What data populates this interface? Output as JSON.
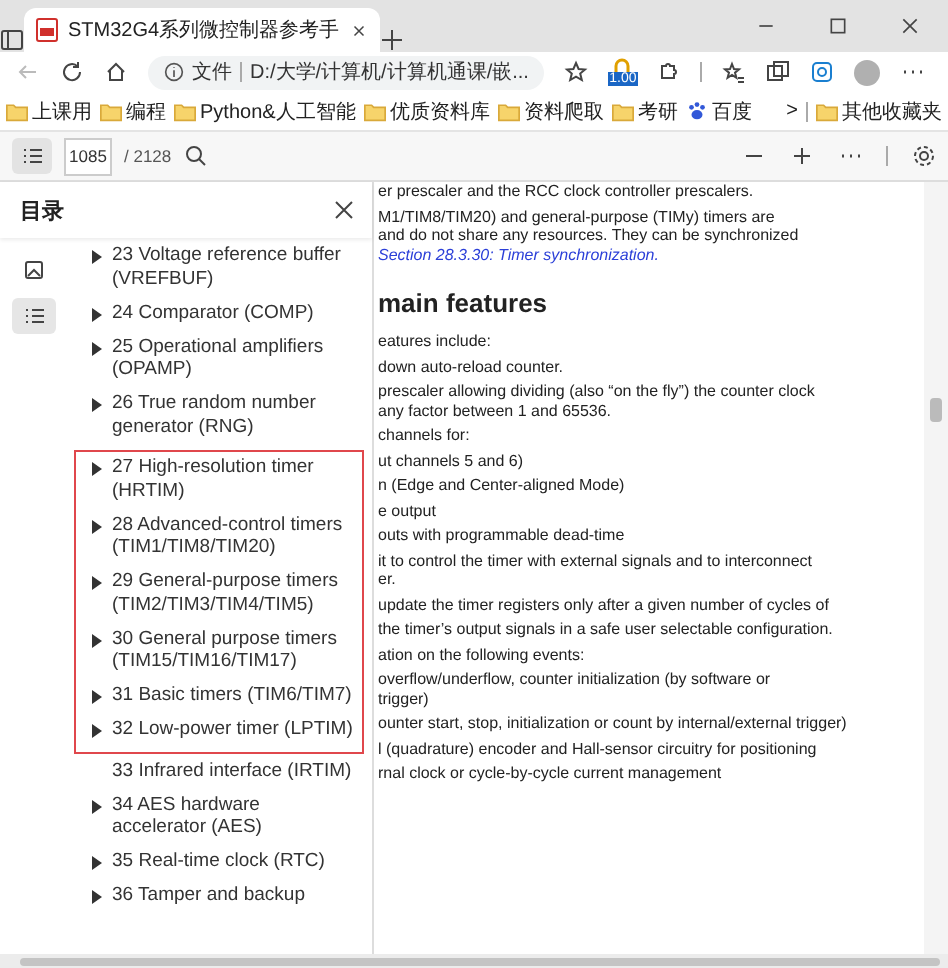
{
  "browser": {
    "tab_title": "STM32G4系列微控制器参考手",
    "address_label": "文件",
    "address": "D:/大学/计算机/计算机通课/嵌...",
    "extension_badge": "1.00",
    "bookmarks": [
      "上课用",
      "编程",
      "Python&人工智能",
      "优质资料库",
      "资料爬取",
      "考研"
    ],
    "baidu": "百度",
    "more": ">",
    "other_bookmarks": "其他收藏夹"
  },
  "pdf_toolbar": {
    "page": "1085",
    "total": "/ 2128"
  },
  "sidebar": {
    "title": "目录",
    "rail": [
      {
        "kind": "thumbnails",
        "selected": false
      },
      {
        "kind": "outline",
        "selected": true
      }
    ],
    "sections": [
      {
        "highlighted": false,
        "items": [
          {
            "label": "23 Voltage reference buffer (VREFBUF)",
            "expandable": true
          },
          {
            "label": "24 Comparator (COMP)",
            "expandable": true
          },
          {
            "label": "25 Operational amplifiers (OPAMP)",
            "expandable": true
          },
          {
            "label": "26 True random number generator (RNG)",
            "expandable": true
          }
        ]
      },
      {
        "highlighted": true,
        "items": [
          {
            "label": "27 High-resolution timer (HRTIM)",
            "expandable": true
          },
          {
            "label": "28 Advanced-control timers (TIM1/TIM8/TIM20)",
            "expandable": true
          },
          {
            "label": "29 General-purpose timers (TIM2/TIM3/TIM4/TIM5)",
            "expandable": true
          },
          {
            "label": "30 General purpose timers (TIM15/TIM16/TIM17)",
            "expandable": true
          },
          {
            "label": "31 Basic timers (TIM6/TIM7)",
            "expandable": true
          },
          {
            "label": "32 Low-power timer (LPTIM)",
            "expandable": true
          }
        ]
      },
      {
        "highlighted": false,
        "items": [
          {
            "label": "33 Infrared interface (IRTIM)",
            "expandable": false
          },
          {
            "label": "34 AES hardware accelerator (AES)",
            "expandable": true
          },
          {
            "label": "35 Real-time clock (RTC)",
            "expandable": true
          },
          {
            "label": "36 Tamper and backup",
            "expandable": true
          }
        ]
      }
    ]
  },
  "document": {
    "blocks": [
      {
        "lines": [
          {
            "kind": "text",
            "text": "er prescaler and the RCC clock controller prescalers."
          }
        ]
      },
      {
        "lines": [
          {
            "kind": "text",
            "text": "M1/TIM8/TIM20) and general-purpose (TIMy) timers are"
          },
          {
            "kind": "text",
            "text": "and do not share any resources. They can be synchronized"
          },
          {
            "kind": "link",
            "text": "Section 28.3.30: Timer synchronization."
          }
        ]
      },
      {
        "lines": [
          {
            "kind": "heading",
            "text": "main features"
          }
        ]
      },
      {
        "lines": [
          {
            "kind": "text",
            "text": "eatures include:"
          }
        ]
      },
      {
        "lines": [
          {
            "kind": "text",
            "text": "down auto-reload counter."
          }
        ]
      },
      {
        "lines": [
          {
            "kind": "text",
            "text": "prescaler allowing dividing (also “on the fly”) the counter clock"
          },
          {
            "kind": "text",
            "text": "any factor between 1 and 65536."
          }
        ]
      },
      {
        "lines": [
          {
            "kind": "text",
            "text": "channels for:"
          }
        ]
      },
      {
        "lines": [
          {
            "kind": "text",
            "text": "ut channels 5 and 6)"
          }
        ]
      },
      {
        "lines": [
          {
            "kind": "text",
            "text": "n (Edge and Center-aligned Mode)"
          }
        ]
      },
      {
        "lines": [
          {
            "kind": "text",
            "text": "e output"
          }
        ]
      },
      {
        "lines": [
          {
            "kind": "text",
            "text": "outs with programmable dead-time"
          }
        ]
      },
      {
        "lines": [
          {
            "kind": "text",
            "text": "it to control the timer with external signals and to interconnect"
          },
          {
            "kind": "text",
            "text": "er."
          }
        ]
      },
      {
        "lines": [
          {
            "kind": "text",
            "text": "update the timer registers only after a given number of cycles of"
          }
        ]
      },
      {
        "lines": [
          {
            "kind": "text",
            "text": "the timer’s output signals in a safe user selectable configuration."
          }
        ]
      },
      {
        "lines": [
          {
            "kind": "text",
            "text": "ation on the following events:"
          }
        ]
      },
      {
        "lines": [
          {
            "kind": "text",
            "text": "overflow/underflow, counter initialization (by software or"
          },
          {
            "kind": "text",
            "text": "trigger)"
          }
        ]
      },
      {
        "lines": [
          {
            "kind": "text",
            "text": "ounter start, stop, initialization or count by internal/external trigger)"
          }
        ]
      },
      {
        "lines": [
          {
            "kind": "text",
            "text": "l (quadrature) encoder and Hall-sensor circuitry for positioning"
          }
        ]
      },
      {
        "lines": [
          {
            "kind": "text",
            "text": "rnal clock or cycle-by-cycle current management"
          }
        ]
      }
    ]
  }
}
